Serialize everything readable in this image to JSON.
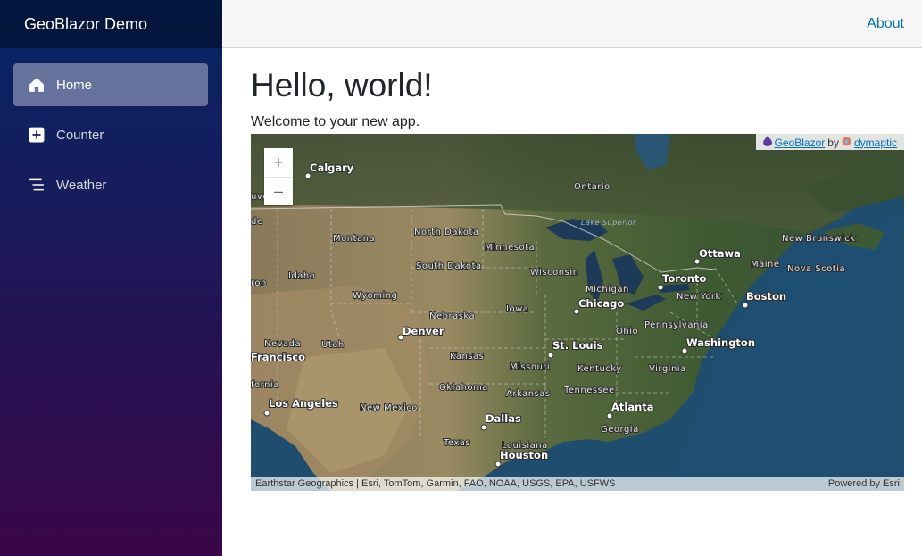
{
  "sidebar": {
    "brand": "GeoBlazor Demo",
    "items": [
      {
        "label": "Home",
        "icon": "home-icon",
        "active": true
      },
      {
        "label": "Counter",
        "icon": "plus-square-icon",
        "active": false
      },
      {
        "label": "Weather",
        "icon": "list-lines-icon",
        "active": false
      }
    ]
  },
  "header": {
    "about": "About"
  },
  "main": {
    "title": "Hello, world!",
    "welcome": "Welcome to your new app."
  },
  "map": {
    "zoom_in": "+",
    "zoom_out": "–",
    "credit_geoblazor": "GeoBlazor",
    "credit_by": "by",
    "credit_dymaptic": "dymaptic",
    "attribution": "Earthstar Geographics | Esri, TomTom, Garmin, FAO, NOAA, USGS, EPA, USFWS",
    "powered_by": "Powered by Esri",
    "states": [
      "Montana",
      "North Dakota",
      "South Dakota",
      "Minnesota",
      "Wisconsin",
      "Michigan",
      "Idaho",
      "Wyoming",
      "Nebraska",
      "Iowa",
      "Nevada",
      "Utah",
      "Kansas",
      "Missouri",
      "Kentucky",
      "Virginia",
      "Oklahoma",
      "Arkansas",
      "Tennessee",
      "Ohio",
      "Pennsylvania",
      "New Mexico",
      "Texas",
      "Louisiana",
      "Georgia",
      "Ontario",
      "Maine",
      "New Brunswick",
      "Nova Scotia",
      "Lake Superior",
      "fornia",
      "ron",
      "uve",
      "de"
    ],
    "cities": [
      "Calgary",
      "Denver",
      "Chicago",
      "St. Louis",
      "Washington",
      "Toronto",
      "Ottawa",
      "New York",
      "Boston",
      "Atlanta",
      "Dallas",
      "Houston",
      "Los Angeles",
      "Francisco"
    ]
  }
}
